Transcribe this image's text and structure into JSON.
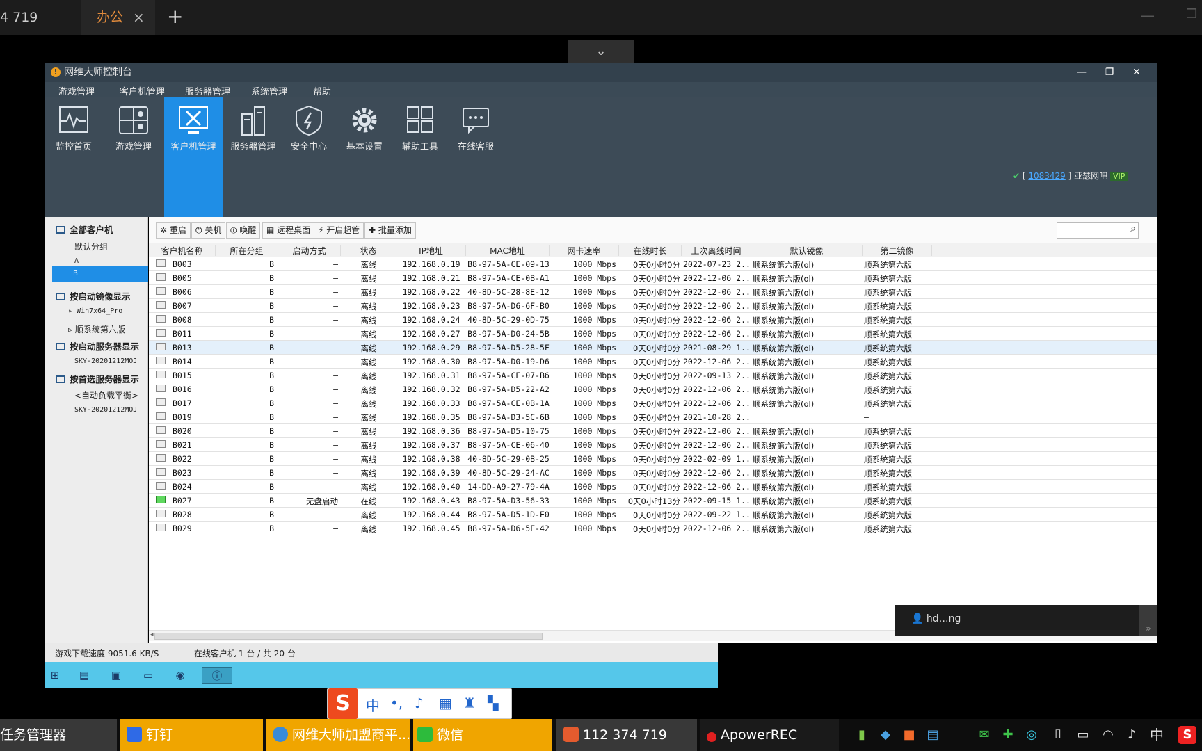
{
  "browser": {
    "tab1": "4 719",
    "tab2": "办公",
    "tab2_close": "×",
    "new_tab": "+"
  },
  "app": {
    "title": "网维大师控制台",
    "menu": [
      "游戏管理",
      "客户机管理",
      "服务器管理",
      "系统管理",
      "帮助"
    ],
    "toolbar": [
      {
        "label": "监控首页",
        "icon": "monitor-pulse-icon"
      },
      {
        "label": "游戏管理",
        "icon": "game-icon"
      },
      {
        "label": "客户机管理",
        "icon": "tools-icon"
      },
      {
        "label": "服务器管理",
        "icon": "server-icon"
      },
      {
        "label": "安全中心",
        "icon": "shield-icon"
      },
      {
        "label": "基本设置",
        "icon": "gear-icon"
      },
      {
        "label": "辅助工具",
        "icon": "grid-icon"
      },
      {
        "label": "在线客服",
        "icon": "chat-icon"
      }
    ],
    "active_toolbar": "客户机管理",
    "account": {
      "id": "1083429",
      "name": "亚瑟网吧",
      "badge": "VIP"
    }
  },
  "sidebar": {
    "all_clients": "全部客户机",
    "groups": [
      "默认分组",
      "A",
      "B"
    ],
    "selected_group": "B",
    "by_image": "按启动镜像显示",
    "images": [
      "Win7x64_Pro",
      "顺系统第六版"
    ],
    "by_server": "按启动服务器显示",
    "servers": [
      "SKY-20201212MOJ"
    ],
    "by_pref_server": "按首选服务器显示",
    "pref_servers": [
      "<自动负载平衡>",
      "SKY-20201212MOJ"
    ]
  },
  "actions": [
    "重启",
    "关机",
    "唤醒",
    "远程桌面",
    "开启超管",
    "批量添加"
  ],
  "table": {
    "columns": [
      "客户机名称",
      "所在分组",
      "启动方式",
      "状态",
      "IP地址",
      "MAC地址",
      "网卡速率",
      "在线时长",
      "上次离线时间",
      "默认镜像",
      "第二镜像"
    ],
    "rows": [
      [
        "B003",
        "B",
        "—",
        "离线",
        "192.168.0.19",
        "B8-97-5A-CE-09-13",
        "1000 Mbps",
        "0天0小时0分",
        "2022-07-23 2...",
        "顺系统第六版(ol)",
        "顺系统第六版"
      ],
      [
        "B005",
        "B",
        "—",
        "离线",
        "192.168.0.21",
        "B8-97-5A-CE-0B-A1",
        "1000 Mbps",
        "0天0小时0分",
        "2022-12-06 2...",
        "顺系统第六版(ol)",
        "顺系统第六版"
      ],
      [
        "B006",
        "B",
        "—",
        "离线",
        "192.168.0.22",
        "40-8D-5C-28-8E-12",
        "1000 Mbps",
        "0天0小时0分",
        "2022-12-06 2...",
        "顺系统第六版(ol)",
        "顺系统第六版"
      ],
      [
        "B007",
        "B",
        "—",
        "离线",
        "192.168.0.23",
        "B8-97-5A-D6-6F-B0",
        "1000 Mbps",
        "0天0小时0分",
        "2022-12-06 2...",
        "顺系统第六版(ol)",
        "顺系统第六版"
      ],
      [
        "B008",
        "B",
        "—",
        "离线",
        "192.168.0.24",
        "40-8D-5C-29-0D-75",
        "1000 Mbps",
        "0天0小时0分",
        "2022-12-06 2...",
        "顺系统第六版(ol)",
        "顺系统第六版"
      ],
      [
        "B011",
        "B",
        "—",
        "离线",
        "192.168.0.27",
        "B8-97-5A-D0-24-5B",
        "1000 Mbps",
        "0天0小时0分",
        "2022-12-06 2...",
        "顺系统第六版(ol)",
        "顺系统第六版"
      ],
      [
        "B013",
        "B",
        "—",
        "离线",
        "192.168.0.29",
        "B8-97-5A-D5-28-5F",
        "1000 Mbps",
        "0天0小时0分",
        "2021-08-29 1...",
        "顺系统第六版(ol)",
        "顺系统第六版"
      ],
      [
        "B014",
        "B",
        "—",
        "离线",
        "192.168.0.30",
        "B8-97-5A-D0-19-D6",
        "1000 Mbps",
        "0天0小时0分",
        "2022-12-06 2...",
        "顺系统第六版(ol)",
        "顺系统第六版"
      ],
      [
        "B015",
        "B",
        "—",
        "离线",
        "192.168.0.31",
        "B8-97-5A-CE-07-B6",
        "1000 Mbps",
        "0天0小时0分",
        "2022-09-13 2...",
        "顺系统第六版(ol)",
        "顺系统第六版"
      ],
      [
        "B016",
        "B",
        "—",
        "离线",
        "192.168.0.32",
        "B8-97-5A-D5-22-A2",
        "1000 Mbps",
        "0天0小时0分",
        "2022-12-06 2...",
        "顺系统第六版(ol)",
        "顺系统第六版"
      ],
      [
        "B017",
        "B",
        "—",
        "离线",
        "192.168.0.33",
        "B8-97-5A-CE-0B-1A",
        "1000 Mbps",
        "0天0小时0分",
        "2022-12-06 2...",
        "顺系统第六版(ol)",
        "顺系统第六版"
      ],
      [
        "B019",
        "B",
        "—",
        "离线",
        "192.168.0.35",
        "B8-97-5A-D3-5C-6B",
        "1000 Mbps",
        "0天0小时0分",
        "2021-10-28 2...",
        "",
        "—"
      ],
      [
        "B020",
        "B",
        "—",
        "离线",
        "192.168.0.36",
        "B8-97-5A-D5-10-75",
        "1000 Mbps",
        "0天0小时0分",
        "2022-12-06 2...",
        "顺系统第六版(ol)",
        "顺系统第六版"
      ],
      [
        "B021",
        "B",
        "—",
        "离线",
        "192.168.0.37",
        "B8-97-5A-CE-06-40",
        "1000 Mbps",
        "0天0小时0分",
        "2022-12-06 2...",
        "顺系统第六版(ol)",
        "顺系统第六版"
      ],
      [
        "B022",
        "B",
        "—",
        "离线",
        "192.168.0.38",
        "40-8D-5C-29-0B-25",
        "1000 Mbps",
        "0天0小时0分",
        "2022-02-09 1...",
        "顺系统第六版(ol)",
        "顺系统第六版"
      ],
      [
        "B023",
        "B",
        "—",
        "离线",
        "192.168.0.39",
        "40-8D-5C-29-24-AC",
        "1000 Mbps",
        "0天0小时0分",
        "2022-12-06 2...",
        "顺系统第六版(ol)",
        "顺系统第六版"
      ],
      [
        "B024",
        "B",
        "—",
        "离线",
        "192.168.0.40",
        "14-DD-A9-27-79-4A",
        "1000 Mbps",
        "0天0小时0分",
        "2022-12-06 2...",
        "顺系统第六版(ol)",
        "顺系统第六版"
      ],
      [
        "B027",
        "B",
        "无盘启动",
        "在线",
        "192.168.0.43",
        "B8-97-5A-D3-56-33",
        "1000 Mbps",
        "0天0小时13分",
        "2022-09-15 1...",
        "顺系统第六版(ol)",
        "顺系统第六版"
      ],
      [
        "B028",
        "B",
        "—",
        "离线",
        "192.168.0.44",
        "B8-97-5A-D5-1D-E0",
        "1000 Mbps",
        "0天0小时0分",
        "2022-09-22 1...",
        "顺系统第六版(ol)",
        "顺系统第六版"
      ],
      [
        "B029",
        "B",
        "—",
        "离线",
        "192.168.0.45",
        "B8-97-5A-D6-5F-42",
        "1000 Mbps",
        "0天0小时0分",
        "2022-12-06 2...",
        "顺系统第六版(ol)",
        "顺系统第六版"
      ]
    ]
  },
  "status": {
    "download": "游戏下载速度 9051.6 KB/S",
    "online": "在线客户机 1 台 / 共 20 台"
  },
  "notification": "hd…ng",
  "taskbar": {
    "items": [
      "任务管理器",
      "钉钉",
      "网维大师加盟商平...",
      "微信",
      "112 374 719",
      "ApowerREC"
    ],
    "ime": "中"
  }
}
